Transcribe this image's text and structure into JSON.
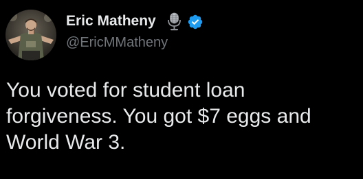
{
  "author": {
    "name": "Eric Matheny",
    "handle": "@EricMMatheny",
    "avatar_icon": "profile-photo",
    "badges": [
      "microphone-icon",
      "verified-badge-icon"
    ]
  },
  "tweet": {
    "text": "You voted for student loan\nforgiveness. You got $7 eggs and\nWorld War 3."
  },
  "colors": {
    "background": "#000000",
    "text_primary": "#e7e9ea",
    "text_secondary": "#71767b",
    "verified_blue": "#1d9bf0"
  }
}
